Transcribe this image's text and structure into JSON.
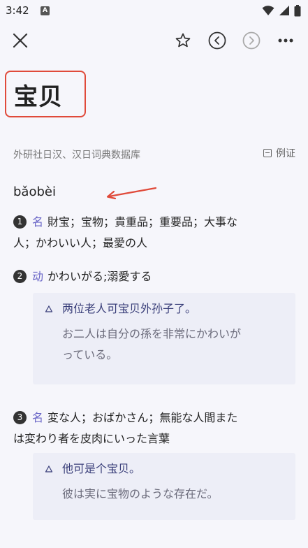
{
  "status": {
    "time": "3:42",
    "a_badge": "A"
  },
  "toolbar": {
    "close_icon": "close-icon",
    "star_icon": "star-icon",
    "prev_icon": "chevron-left-circle-icon",
    "next_icon": "chevron-right-circle-icon",
    "more_icon": "more-icon"
  },
  "entry": {
    "headword": "宝贝",
    "source": "外研社日汉、汉日词典数据库",
    "examples_toggle": "例证",
    "pinyin": "bǎobèi"
  },
  "senses": [
    {
      "num": "1",
      "pos": "名",
      "text_line1": "財宝；宝物；貴重品；重要品；大事な",
      "text_line2": "人；かわいい人；最愛の人"
    },
    {
      "num": "2",
      "pos": "动",
      "text_line1": "かわいがる;溺愛する",
      "example": {
        "zh": "两位老人可宝贝外孙子了。",
        "ja_line1": "お二人は自分の孫を非常にかわいが",
        "ja_line2": "っている。"
      }
    },
    {
      "num": "3",
      "pos": "名",
      "text_line1": "変な人；おばかさん；無能な人間また",
      "text_line2": "は変わり者を皮肉にいった言葉",
      "example": {
        "zh": "他可是个宝贝。",
        "ja_line1": "彼は実に宝物のような存在だ。"
      }
    }
  ],
  "colors": {
    "accent": "#6a66c7",
    "highlight_box": "#e04a3a",
    "example_bg": "#edeef7"
  }
}
